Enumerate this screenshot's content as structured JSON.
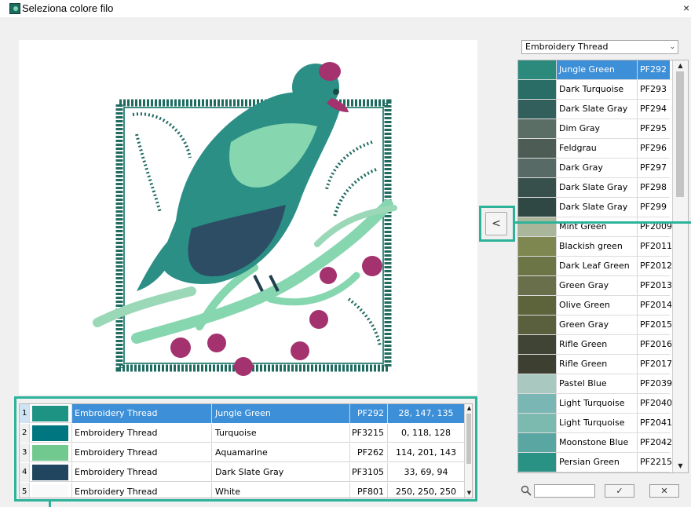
{
  "window": {
    "title": "Seleziona colore filo",
    "close_glyph": "×"
  },
  "thread_table": {
    "rows": [
      {
        "index": "1",
        "swatch": "#1c9383",
        "brand": "Embroidery Thread",
        "name": "Jungle Green",
        "code": "PF292",
        "rgb": "28, 147, 135",
        "selected": true
      },
      {
        "index": "2",
        "swatch": "#007680",
        "brand": "Embroidery Thread",
        "name": "Turquoise",
        "code": "PF3215",
        "rgb": "0, 118, 128",
        "selected": false
      },
      {
        "index": "3",
        "swatch": "#72c98f",
        "brand": "Embroidery Thread",
        "name": "Aquamarine",
        "code": "PF262",
        "rgb": "114, 201, 143",
        "selected": false
      },
      {
        "index": "4",
        "swatch": "#21455e",
        "brand": "Embroidery Thread",
        "name": "Dark Slate Gray",
        "code": "PF3105",
        "rgb": "33, 69, 94",
        "selected": false
      },
      {
        "index": "5",
        "swatch": "#fafafa",
        "brand": "Embroidery Thread",
        "name": "White",
        "code": "PF801",
        "rgb": "250, 250, 250",
        "selected": false
      }
    ]
  },
  "transfer_button": {
    "glyph": "<",
    "icon": "chevron-left-icon"
  },
  "palette": {
    "brand_dropdown": {
      "value": "Embroidery Thread",
      "icon": "chevron-down-icon"
    },
    "items": [
      {
        "swatch": "#2c8a7c",
        "name": "Jungle Green",
        "code": "PF292",
        "selected": true
      },
      {
        "swatch": "#2a6d66",
        "name": "Dark Turquoise",
        "code": "PF293",
        "selected": false
      },
      {
        "swatch": "#325f5c",
        "name": "Dark Slate Gray",
        "code": "PF294",
        "selected": false
      },
      {
        "swatch": "#5a6e66",
        "name": "Dim Gray",
        "code": "PF295",
        "selected": false
      },
      {
        "swatch": "#4d5d55",
        "name": "Feldgrau",
        "code": "PF296",
        "selected": false
      },
      {
        "swatch": "#586a66",
        "name": "Dark Gray",
        "code": "PF297",
        "selected": false
      },
      {
        "swatch": "#38504b",
        "name": "Dark Slate Gray",
        "code": "PF298",
        "selected": false
      },
      {
        "swatch": "#2f4843",
        "name": "Dark Slate Gray",
        "code": "PF299",
        "selected": false
      },
      {
        "swatch": "#a9b69a",
        "name": "Mint Green",
        "code": "PF2009",
        "selected": false
      },
      {
        "swatch": "#7f8750",
        "name": "Blackish green",
        "code": "PF2011",
        "selected": false
      },
      {
        "swatch": "#6c7546",
        "name": "Dark Leaf Green",
        "code": "PF2012",
        "selected": false
      },
      {
        "swatch": "#696f4a",
        "name": "Green Gray",
        "code": "PF2013",
        "selected": false
      },
      {
        "swatch": "#5d643c",
        "name": "Olive Green",
        "code": "PF2014",
        "selected": false
      },
      {
        "swatch": "#5a5f3d",
        "name": "Green Gray",
        "code": "PF2015",
        "selected": false
      },
      {
        "swatch": "#404434",
        "name": "Rifle Green",
        "code": "PF2016",
        "selected": false
      },
      {
        "swatch": "#3d3f31",
        "name": "Rifle Green",
        "code": "PF2017",
        "selected": false
      },
      {
        "swatch": "#a8c8c0",
        "name": "Pastel Blue",
        "code": "PF2039",
        "selected": false
      },
      {
        "swatch": "#7ab6b4",
        "name": "Light Turquoise",
        "code": "PF2040",
        "selected": false
      },
      {
        "swatch": "#7cbab0",
        "name": "Light Turquoise",
        "code": "PF2041",
        "selected": false
      },
      {
        "swatch": "#5aa6a2",
        "name": "Moonstone Blue",
        "code": "PF2042",
        "selected": false
      },
      {
        "swatch": "#2a9285",
        "name": "Persian Green",
        "code": "PF2215",
        "selected": false
      }
    ]
  },
  "search": {
    "value": "",
    "icon": "search-icon"
  },
  "ok_button": {
    "glyph": "✓"
  },
  "cancel_button": {
    "glyph": "✕"
  },
  "colors": {
    "highlight": "#2db39a",
    "selection": "#3d8fd8"
  }
}
